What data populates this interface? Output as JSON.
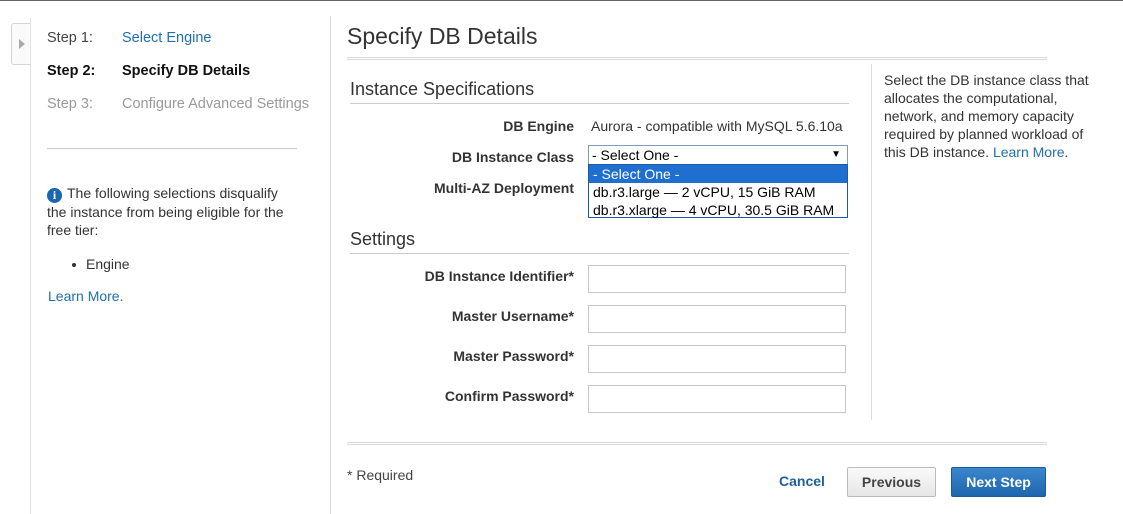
{
  "wizard": {
    "steps": [
      {
        "num": "Step 1:",
        "label": "Select Engine"
      },
      {
        "num": "Step 2:",
        "label": "Specify DB Details"
      },
      {
        "num": "Step 3:",
        "label": "Configure Advanced Settings"
      }
    ],
    "current_step": 2
  },
  "sidebar": {
    "info_text": "The following selections disqualify the instance from being eligible for the free tier:",
    "list_items": [
      "Engine"
    ],
    "learn_more": "Learn More"
  },
  "main": {
    "title": "Specify DB Details",
    "instance_specs": {
      "heading": "Instance Specifications",
      "engine_label": "DB Engine",
      "engine_value": "Aurora - compatible with MySQL 5.6.10a",
      "class_label": "DB Instance Class",
      "class_selected": "- Select One -",
      "class_options": [
        "- Select One -",
        "db.r3.large — 2 vCPU, 15 GiB RAM",
        "db.r3.xlarge — 4 vCPU, 30.5 GiB RAM"
      ],
      "class_highlighted_index": 0,
      "multi_az_label": "Multi-AZ Deployment"
    },
    "settings": {
      "heading": "Settings",
      "identifier_label": "DB Instance Identifier*",
      "identifier_value": "",
      "username_label": "Master Username*",
      "username_value": "",
      "password_label": "Master Password*",
      "password_value": "",
      "confirm_label": "Confirm Password*",
      "confirm_value": ""
    }
  },
  "help": {
    "text": "Select the DB instance class that allocates the computational, network, and memory capacity required by planned workload of this DB instance.",
    "learn_more": "Learn More"
  },
  "footer": {
    "required_note": "* Required",
    "cancel": "Cancel",
    "previous": "Previous",
    "next": "Next Step"
  },
  "colors": {
    "link": "#1f6fb2",
    "primary_button": "#1f66ae",
    "dropdown_highlight": "#1f6fd0"
  }
}
